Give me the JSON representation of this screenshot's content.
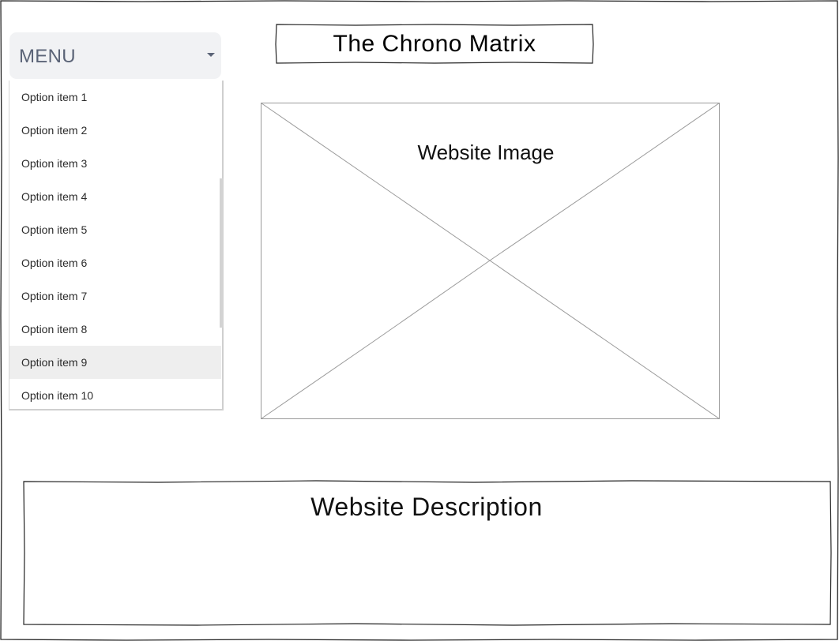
{
  "header": {
    "title": "The Chrono Matrix"
  },
  "menu": {
    "label": "MENU",
    "caret_icon": "caret-down-icon",
    "items": [
      {
        "label": "Option item 1"
      },
      {
        "label": "Option item 2"
      },
      {
        "label": "Option item 3"
      },
      {
        "label": "Option item 4"
      },
      {
        "label": "Option item 5"
      },
      {
        "label": "Option item 6"
      },
      {
        "label": "Option item 7"
      },
      {
        "label": "Option item 8"
      },
      {
        "label": "Option item 9",
        "highlighted": true
      },
      {
        "label": "Option item 10"
      }
    ]
  },
  "main": {
    "image_placeholder_label": "Website Image",
    "description_title": "Website Description"
  },
  "colors": {
    "menu_header_bg": "#f1f2f4",
    "menu_text": "#5b6477",
    "item_highlight": "#eeeeee",
    "sketch_stroke": "#222222",
    "placeholder_stroke": "#9a9a9a"
  }
}
